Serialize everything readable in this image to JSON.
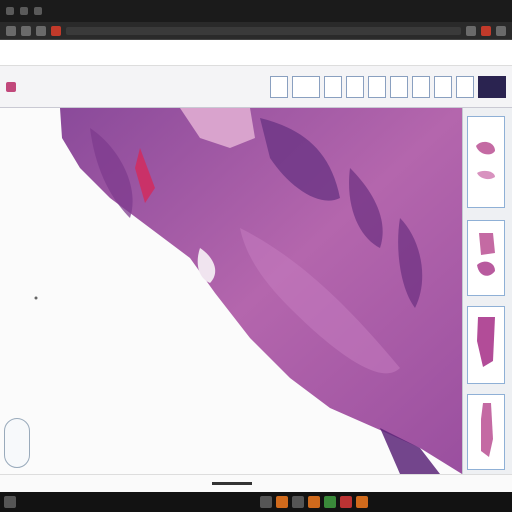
{
  "chrome": {
    "title_left": "",
    "title_right": ""
  },
  "viewer": {
    "title": "",
    "tools": [
      "",
      "",
      "",
      "",
      "",
      "",
      "",
      "",
      "",
      ""
    ]
  },
  "thumbnails": [
    {
      "label": ""
    },
    {
      "label": ""
    },
    {
      "label": ""
    },
    {
      "label": ""
    }
  ],
  "zoom": {
    "value": ""
  },
  "status": {
    "text": ""
  },
  "taskbar": {
    "tray": ""
  },
  "colors": {
    "tissue_dark": "#7a3f8f",
    "tissue_mid": "#b05aa6",
    "tissue_light": "#d98fc6",
    "background": "#fbfbfb",
    "accent": "#2a2350"
  }
}
